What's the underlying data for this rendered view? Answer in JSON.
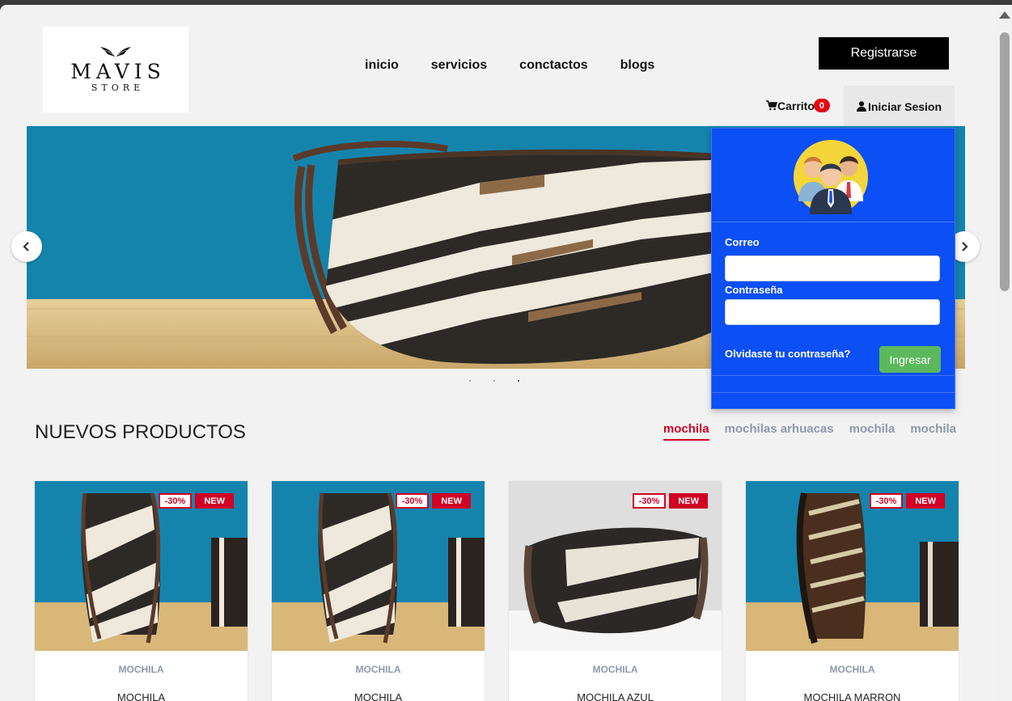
{
  "brand": {
    "name": "MAVIS",
    "sub": "STORE"
  },
  "nav": {
    "items": [
      "inicio",
      "servicios",
      "conctactos",
      "blogs"
    ]
  },
  "header": {
    "register_label": "Registrarse",
    "cart_label": "Carrito",
    "cart_count": "0",
    "login_label": "Iniciar Sesion"
  },
  "login": {
    "email_label": "Correo",
    "password_label": "Contraseña",
    "forgot_label": "Olvidaste tu contraseña?",
    "submit_label": "Ingresar"
  },
  "products": {
    "title": "NUEVOS PRODUCTOS",
    "tabs": [
      "mochila",
      "mochilas arhuacas",
      "mochila",
      "mochila"
    ],
    "active_tab": 0,
    "items": [
      {
        "discount": "-30%",
        "badge": "NEW",
        "category": "MOCHILA",
        "name": "MOCHILA"
      },
      {
        "discount": "-30%",
        "badge": "NEW",
        "category": "MOCHILA",
        "name": "MOCHILA"
      },
      {
        "discount": "-30%",
        "badge": "NEW",
        "category": "MOCHILA",
        "name": "MOCHILA AZUL"
      },
      {
        "discount": "-30%",
        "badge": "NEW",
        "category": "MOCHILA",
        "name": "MOCHILA MARRON"
      }
    ]
  },
  "colors": {
    "accent": "#d10024",
    "login_panel": "#0b4ff5",
    "login_button": "#5cb85c",
    "hero_bg": "#1584ad"
  },
  "icons": {
    "cart": "cart-icon",
    "user": "user-icon",
    "prev": "chevron-left-icon",
    "next": "chevron-right-icon"
  }
}
